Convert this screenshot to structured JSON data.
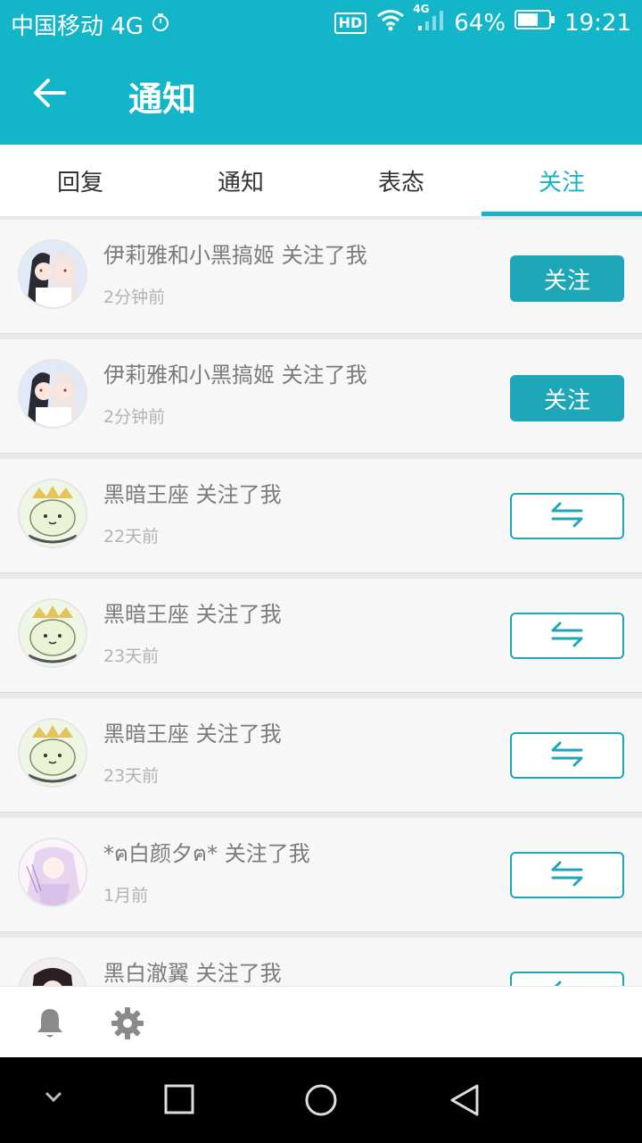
{
  "status_bar": {
    "carrier": "中国移动 4G",
    "hd_badge": "HD",
    "network": "4G",
    "battery": "64%",
    "time": "19:21"
  },
  "header": {
    "title": "通知",
    "back_icon": "arrow-left-icon"
  },
  "tabs": [
    {
      "label": "回复",
      "active": false
    },
    {
      "label": "通知",
      "active": false
    },
    {
      "label": "表态",
      "active": false
    },
    {
      "label": "关注",
      "active": true
    }
  ],
  "items": [
    {
      "text": "伊莉雅和小黑搞姬 关注了我",
      "time": "2分钟前",
      "button": "关注"
    },
    {
      "text": "伊莉雅和小黑搞姬 关注了我",
      "time": "2分钟前",
      "button": "关注"
    },
    {
      "text": "黑暗王座 关注了我",
      "time": "22天前",
      "button_icon": "mutual-follow-icon"
    },
    {
      "text": "黑暗王座 关注了我",
      "time": "23天前",
      "button_icon": "mutual-follow-icon"
    },
    {
      "text": "黑暗王座 关注了我",
      "time": "23天前",
      "button_icon": "mutual-follow-icon"
    },
    {
      "text": "*ฅ白颜夕ฅ* 关注了我",
      "time": "1月前",
      "button_icon": "mutual-follow-icon"
    },
    {
      "text": "黑白澈翼 关注了我",
      "time": "",
      "button_icon": "mutual-follow-icon"
    }
  ],
  "bottom_bar": {
    "icons": [
      "bell-icon",
      "gear-icon"
    ]
  },
  "colors": {
    "accent": "#13b5c8",
    "button": "#1ea7b8",
    "text_secondary": "#7b7b7b"
  }
}
